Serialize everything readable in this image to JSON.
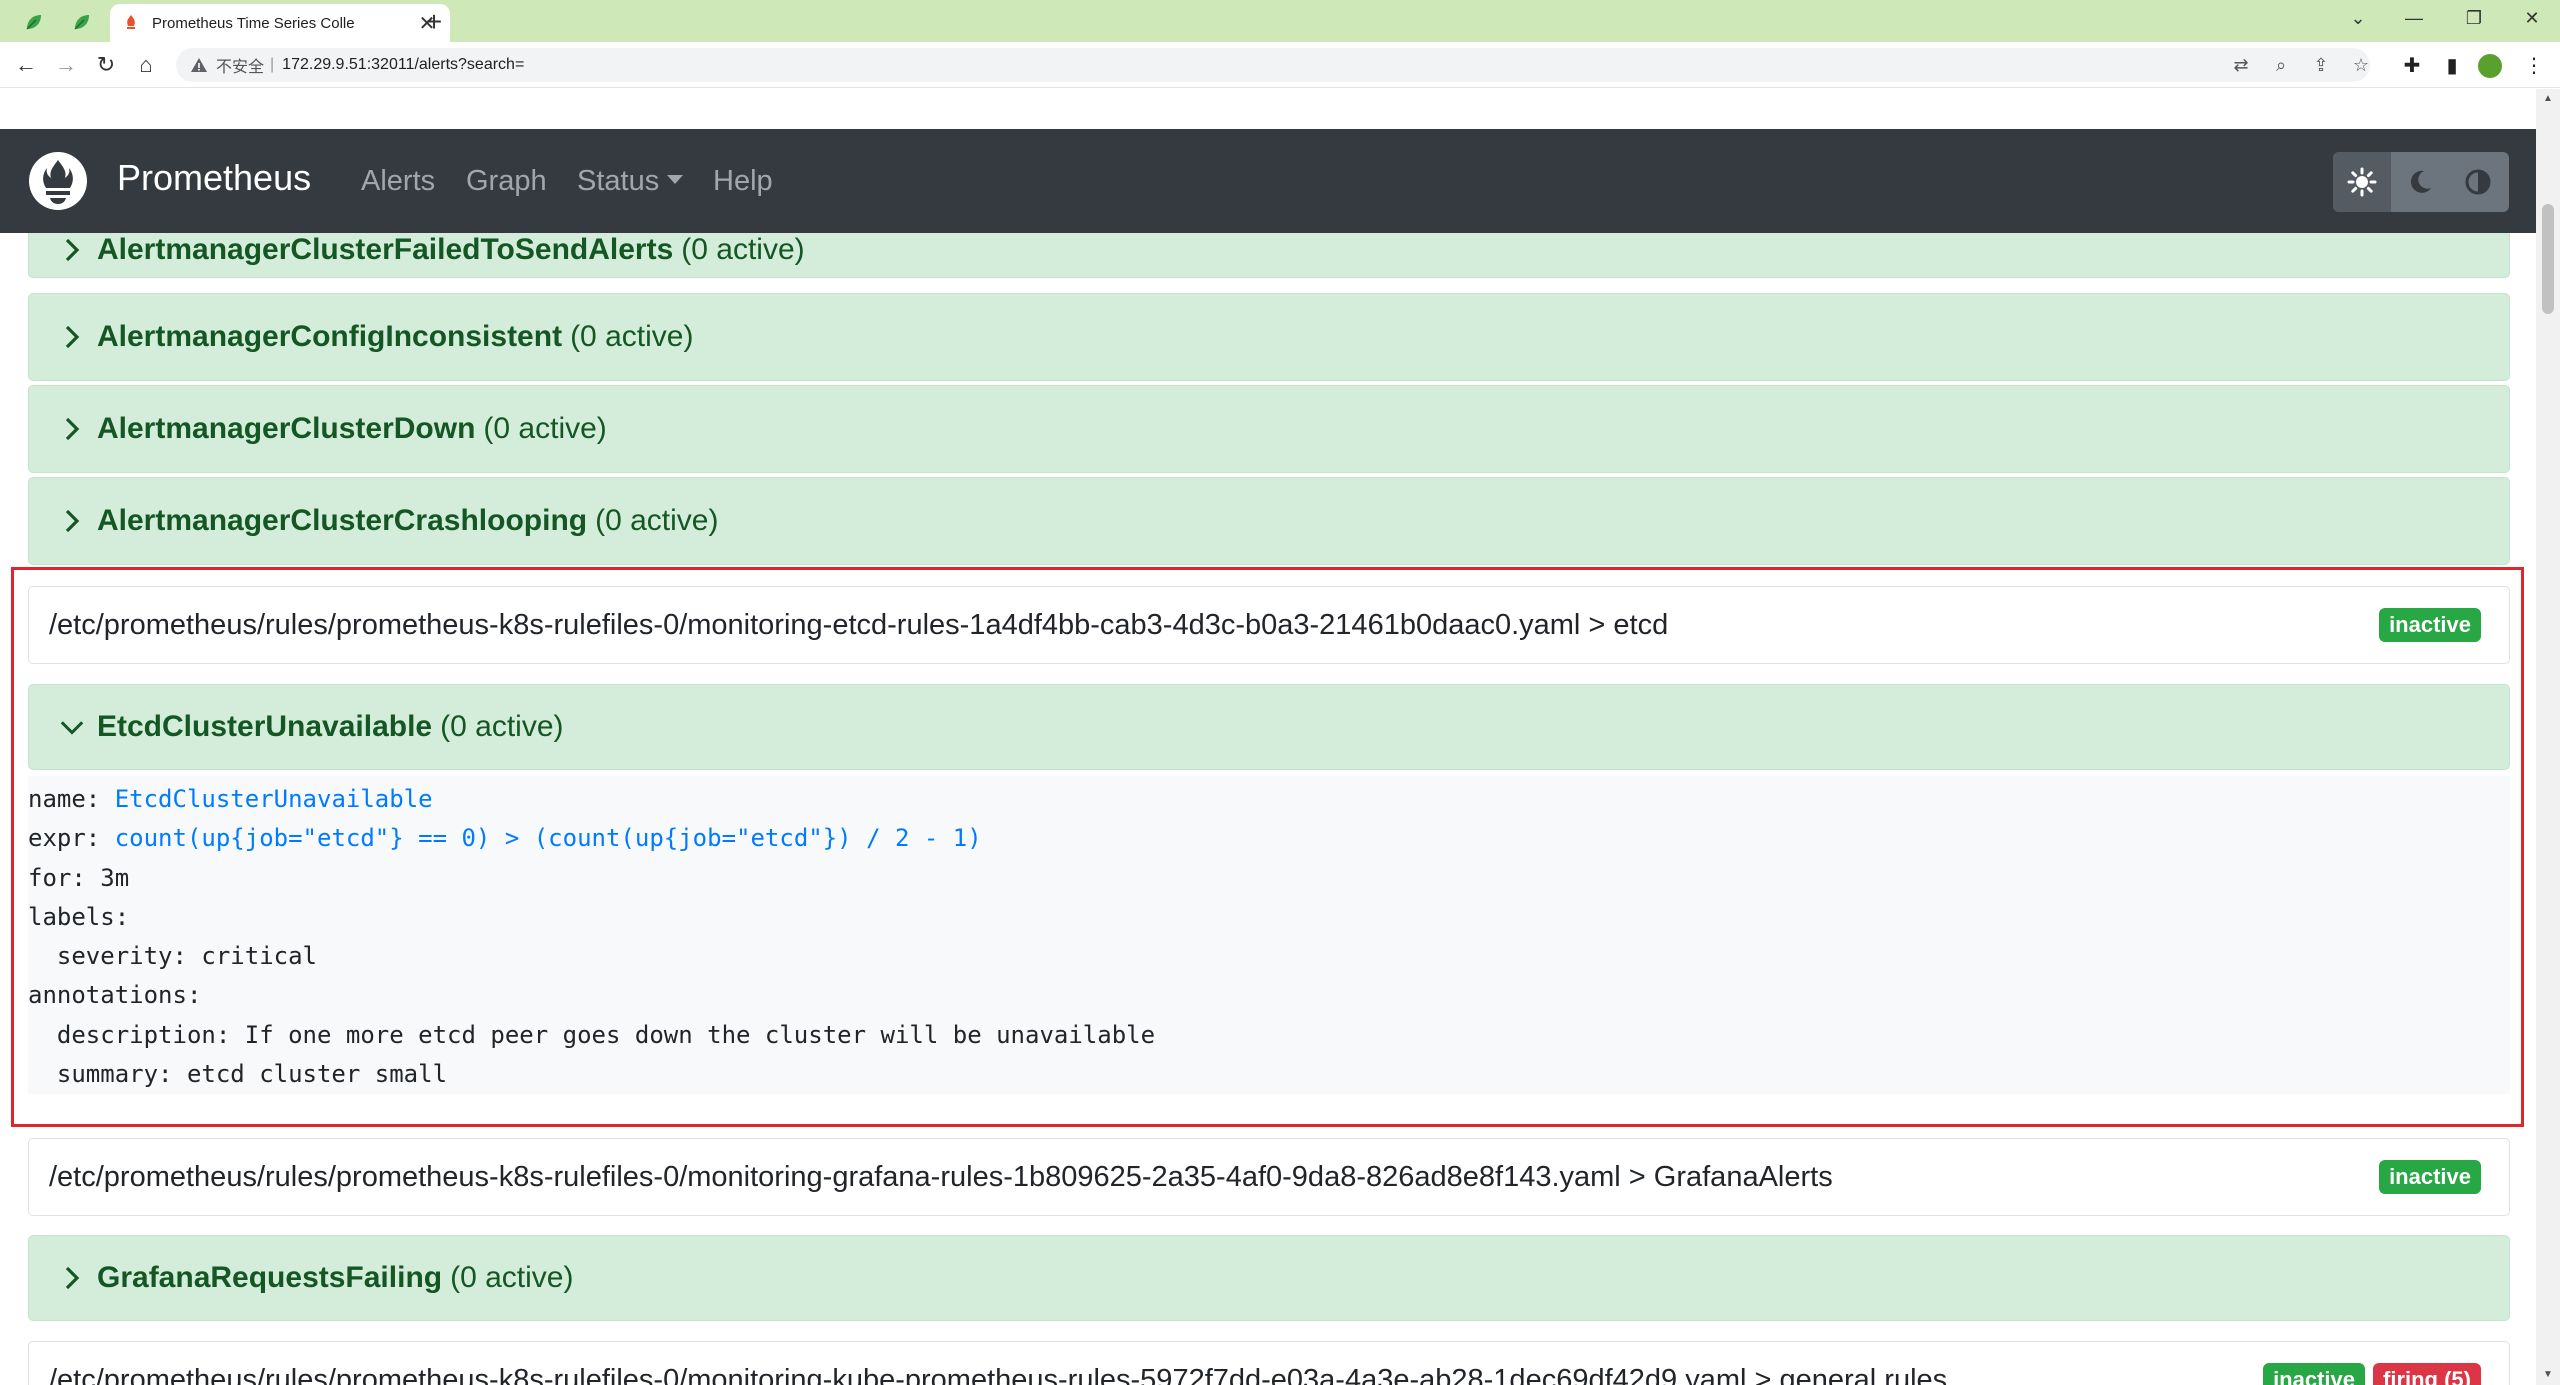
{
  "browser": {
    "tab_title": "Prometheus Time Series Colle",
    "tab_close": "✕",
    "new_tab": "+",
    "security_label": "不安全",
    "separator": "|",
    "url": "172.29.9.51:32011/alerts?search="
  },
  "navbar": {
    "brand": "Prometheus",
    "links": {
      "alerts": "Alerts",
      "graph": "Graph",
      "status": "Status",
      "help": "Help"
    },
    "theme_buttons": [
      "light-theme",
      "dark-theme",
      "browser-theme"
    ],
    "active_theme": "light-theme"
  },
  "rules_top": [
    {
      "name": "AlertmanagerClusterFailedToSendAlerts",
      "count": "(0 active)"
    },
    {
      "name": "AlertmanagerConfigInconsistent",
      "count": "(0 active)"
    },
    {
      "name": "AlertmanagerClusterDown",
      "count": "(0 active)"
    },
    {
      "name": "AlertmanagerClusterCrashlooping",
      "count": "(0 active)"
    }
  ],
  "etcd_group": {
    "path": "/etc/prometheus/rules/prometheus-k8s-rulefiles-0/monitoring-etcd-rules-1a4df4bb-cab3-4d3c-b0a3-21461b0daac0.yaml > etcd",
    "badge": "inactive",
    "rule": {
      "name": "EtcdClusterUnavailable",
      "count": "(0 active)"
    },
    "definition": {
      "name_key": "name: ",
      "name_val": "EtcdClusterUnavailable",
      "expr_key": "expr: ",
      "expr_val": "count(up{job=\"etcd\"} == 0) > (count(up{job=\"etcd\"}) / 2 - 1)",
      "for_line": "for: 3m",
      "labels_line": "labels:",
      "severity_line": "  severity: critical",
      "annotations_line": "annotations:",
      "description_line": "  description: If one more etcd peer goes down the cluster will be unavailable",
      "summary_line": "  summary: etcd cluster small"
    }
  },
  "grafana_group": {
    "path": "/etc/prometheus/rules/prometheus-k8s-rulefiles-0/monitoring-grafana-rules-1b809625-2a35-4af0-9da8-826ad8e8f143.yaml > GrafanaAlerts",
    "badge": "inactive",
    "rule": {
      "name": "GrafanaRequestsFailing",
      "count": "(0 active)"
    }
  },
  "general_group": {
    "path": "/etc/prometheus/rules/prometheus-k8s-rulefiles-0/monitoring-kube-prometheus-rules-5972f7dd-e03a-4a3e-ab28-1dec69df42d9.yaml > general.rules",
    "badges": [
      "inactive",
      "firing (5)"
    ]
  },
  "colors": {
    "navbar_bg": "#343a40",
    "rule_row_bg": "#d4edda",
    "rule_text": "#155724",
    "badge_inactive": "#28a745",
    "badge_firing": "#dc3545",
    "highlight": "#e0262d",
    "link_value": "#007bff"
  }
}
